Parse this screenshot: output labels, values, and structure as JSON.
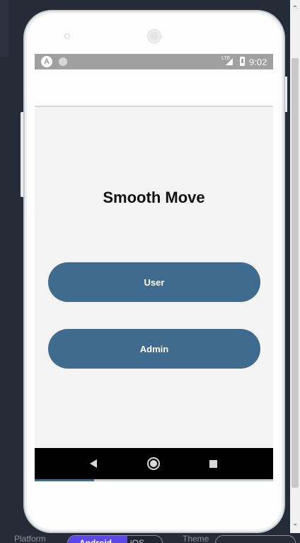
{
  "status_bar": {
    "time": "9:02",
    "network": "LTE",
    "icons": [
      "app-a-icon",
      "notification-dot-icon",
      "signal-icon",
      "battery-icon"
    ]
  },
  "app": {
    "title": "Smooth Move",
    "buttons": {
      "user": "User",
      "admin": "Admin"
    },
    "button_color": "#3e6b8e"
  },
  "nav_bar": {
    "icons": [
      "back-icon",
      "home-icon",
      "recent-apps-icon"
    ]
  },
  "loading_progress": 0.25,
  "toolbar": {
    "platform_label": "Platform",
    "platforms": [
      "Android",
      "iOS"
    ],
    "selected_platform": "Android",
    "theme_label": "Theme"
  },
  "colors": {
    "accent": "#5b47e6",
    "ide_background": "#252c38"
  }
}
